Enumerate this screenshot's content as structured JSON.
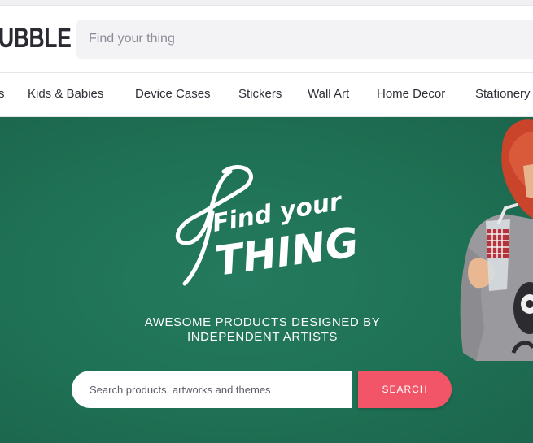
{
  "header": {
    "logo_text": "UBBLE",
    "search_placeholder": "Find your thing"
  },
  "nav": {
    "items": [
      {
        "label": "s"
      },
      {
        "label": "Kids & Babies"
      },
      {
        "label": "Device Cases"
      },
      {
        "label": "Stickers"
      },
      {
        "label": "Wall Art"
      },
      {
        "label": "Home Decor"
      },
      {
        "label": "Stationery"
      }
    ]
  },
  "hero": {
    "title_line1": "Find your",
    "title_line2": "THING",
    "tagline_line1": "AWESOME PRODUCTS DESIGNED BY",
    "tagline_line2": "INDEPENDENT ARTISTS",
    "search_placeholder": "Search products, artworks and themes",
    "search_button": "SEARCH"
  },
  "colors": {
    "hero_bg": "#1f7155",
    "search_button": "#f25567",
    "nav_text": "#2f2f38"
  }
}
